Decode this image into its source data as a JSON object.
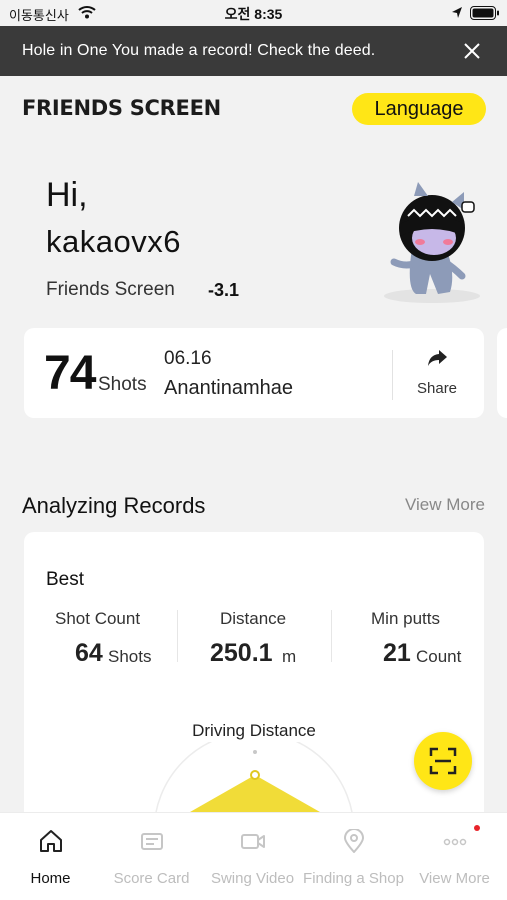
{
  "status_bar": {
    "carrier": "이동통신사",
    "time": "오전 8:35"
  },
  "banner": {
    "text": "Hole in One You made a record! Check the deed."
  },
  "header": {
    "brand": "FRIENDS SCREEN",
    "language_button": "Language"
  },
  "profile": {
    "greeting": "Hi,",
    "username": "kakaovx6",
    "handicap_label": "Friends Screen",
    "handicap_value": "-3.1"
  },
  "last_round": {
    "shots": "74",
    "shots_unit": "Shots",
    "date": "06.16",
    "course": "Anantinamhae",
    "share_label": "Share"
  },
  "records": {
    "title": "Analyzing Records",
    "view_more": "View More",
    "best_label": "Best",
    "stats": [
      {
        "label": "Shot Count",
        "value": "64",
        "unit": "Shots"
      },
      {
        "label": "Distance",
        "value": "250.1",
        "unit": "m"
      },
      {
        "label": "Min putts",
        "value": "21",
        "unit": "Count"
      }
    ],
    "driving_label": "Driving Distance"
  },
  "tabs": [
    {
      "label": "Home",
      "icon": "home-icon",
      "active": true
    },
    {
      "label": "Score Card",
      "icon": "score-card-icon",
      "active": false
    },
    {
      "label": "Swing Video",
      "icon": "video-camera-icon",
      "active": false
    },
    {
      "label": "Finding a Shop",
      "icon": "location-pin-icon",
      "active": false
    },
    {
      "label": "View More",
      "icon": "more-dots-icon",
      "active": false,
      "notification": true
    }
  ],
  "colors": {
    "accent_yellow": "#ffe616",
    "banner_bg": "#3a3a3a",
    "notification_red": "#e8232a",
    "page_bg": "#f2f2f2"
  }
}
